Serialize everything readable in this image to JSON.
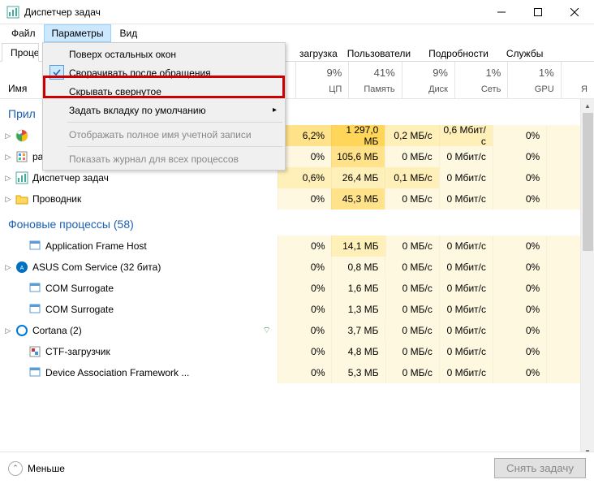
{
  "window": {
    "title": "Диспетчер задач"
  },
  "menubar": {
    "file": "Файл",
    "options": "Параметры",
    "view": "Вид"
  },
  "dropdown": {
    "always_on_top": "Поверх остальных окон",
    "minimize_on_use": "Сворачивать после обращения",
    "hide_when_minimized": "Скрывать свернутое",
    "set_default_tab": "Задать вкладку по умолчанию",
    "show_full_account": "Отображать полное имя учетной записи",
    "show_history": "Показать журнал для всех процессов"
  },
  "tabs": {
    "processes_partial": "Проце",
    "startup_partial": "загрузка",
    "users": "Пользователи",
    "details": "Подробности",
    "services": "Службы"
  },
  "headers": {
    "name": "Имя",
    "cpu_pct": "9%",
    "cpu": "ЦП",
    "mem_pct": "41%",
    "mem": "Память",
    "disk_pct": "9%",
    "disk": "Диск",
    "net_pct": "1%",
    "net": "Сеть",
    "gpu_pct": "1%",
    "gpu": "GPU",
    "extra": "Я"
  },
  "groups": {
    "apps": "Прил",
    "background": "Фоновые процессы (58)"
  },
  "rows": [
    {
      "name": "",
      "cpu": "6,2%",
      "mem": "1 297,0 МБ",
      "disk": "0,2 МБ/с",
      "net": "0,6 Мбит/с",
      "gpu": "0%",
      "icon": "chrome",
      "exp": true,
      "cpu_h": 2,
      "mem_h": 3,
      "disk_h": 1,
      "net_h": 1,
      "gpu_h": 0
    },
    {
      "name": "paint.net",
      "cpu": "0%",
      "mem": "105,6 МБ",
      "disk": "0 МБ/с",
      "net": "0 Мбит/с",
      "gpu": "0%",
      "icon": "paint",
      "exp": true,
      "cpu_h": 0,
      "mem_h": 2,
      "disk_h": 0,
      "net_h": 0,
      "gpu_h": 0
    },
    {
      "name": "Диспетчер задач",
      "cpu": "0,6%",
      "mem": "26,4 МБ",
      "disk": "0,1 МБ/с",
      "net": "0 Мбит/с",
      "gpu": "0%",
      "icon": "taskmgr",
      "exp": true,
      "cpu_h": 1,
      "mem_h": 1,
      "disk_h": 1,
      "net_h": 0,
      "gpu_h": 0
    },
    {
      "name": "Проводник",
      "cpu": "0%",
      "mem": "45,3 МБ",
      "disk": "0 МБ/с",
      "net": "0 Мбит/с",
      "gpu": "0%",
      "icon": "explorer",
      "exp": true,
      "cpu_h": 0,
      "mem_h": 2,
      "disk_h": 0,
      "net_h": 0,
      "gpu_h": 0
    }
  ],
  "bg_rows": [
    {
      "name": "Application Frame Host",
      "cpu": "0%",
      "mem": "14,1 МБ",
      "disk": "0 МБ/с",
      "net": "0 Мбит/с",
      "gpu": "0%",
      "icon": "generic",
      "exp": false,
      "cpu_h": 0,
      "mem_h": 1,
      "disk_h": 0,
      "net_h": 0,
      "gpu_h": 0
    },
    {
      "name": "ASUS Com Service (32 бита)",
      "cpu": "0%",
      "mem": "0,8 МБ",
      "disk": "0 МБ/с",
      "net": "0 Мбит/с",
      "gpu": "0%",
      "icon": "asus",
      "exp": true,
      "cpu_h": 0,
      "mem_h": 0,
      "disk_h": 0,
      "net_h": 0,
      "gpu_h": 0
    },
    {
      "name": "COM Surrogate",
      "cpu": "0%",
      "mem": "1,6 МБ",
      "disk": "0 МБ/с",
      "net": "0 Мбит/с",
      "gpu": "0%",
      "icon": "generic",
      "exp": false,
      "cpu_h": 0,
      "mem_h": 0,
      "disk_h": 0,
      "net_h": 0,
      "gpu_h": 0
    },
    {
      "name": "COM Surrogate",
      "cpu": "0%",
      "mem": "1,3 МБ",
      "disk": "0 МБ/с",
      "net": "0 Мбит/с",
      "gpu": "0%",
      "icon": "generic",
      "exp": false,
      "cpu_h": 0,
      "mem_h": 0,
      "disk_h": 0,
      "net_h": 0,
      "gpu_h": 0
    },
    {
      "name": "Cortana (2)",
      "cpu": "0%",
      "mem": "3,7 МБ",
      "disk": "0 МБ/с",
      "net": "0 Мбит/с",
      "gpu": "0%",
      "icon": "cortana",
      "exp": true,
      "leaf": true,
      "cpu_h": 0,
      "mem_h": 0,
      "disk_h": 0,
      "net_h": 0,
      "gpu_h": 0
    },
    {
      "name": "CTF-загрузчик",
      "cpu": "0%",
      "mem": "4,8 МБ",
      "disk": "0 МБ/с",
      "net": "0 Мбит/с",
      "gpu": "0%",
      "icon": "ctf",
      "exp": false,
      "cpu_h": 0,
      "mem_h": 0,
      "disk_h": 0,
      "net_h": 0,
      "gpu_h": 0
    },
    {
      "name": "Device Association Framework ...",
      "cpu": "0%",
      "mem": "5,3 МБ",
      "disk": "0 МБ/с",
      "net": "0 Мбит/с",
      "gpu": "0%",
      "icon": "generic",
      "exp": false,
      "cpu_h": 0,
      "mem_h": 0,
      "disk_h": 0,
      "net_h": 0,
      "gpu_h": 0
    }
  ],
  "footer": {
    "fewer": "Меньше",
    "end_task": "Снять задачу"
  }
}
